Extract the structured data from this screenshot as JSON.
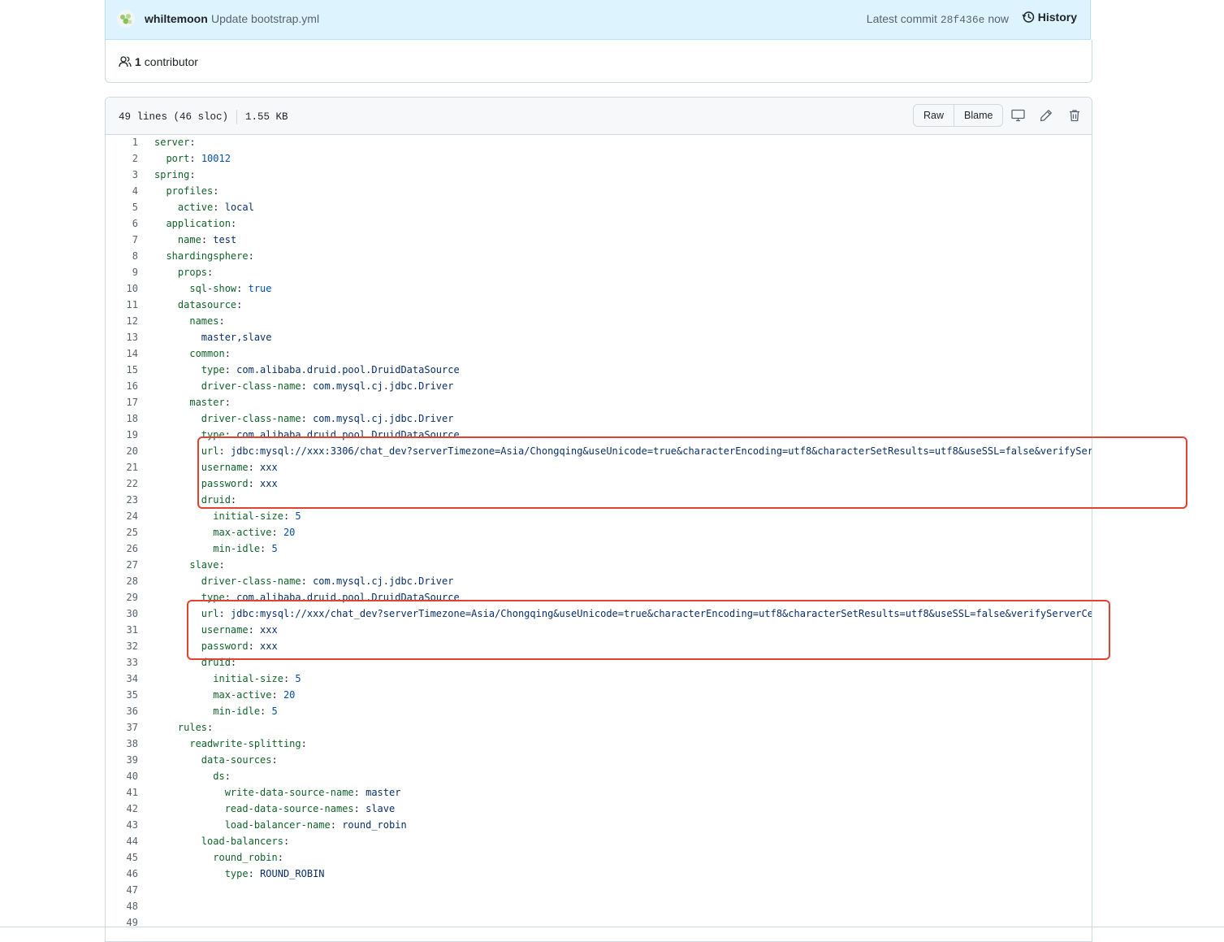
{
  "commit": {
    "author": "whiltemoon",
    "message": "Update bootstrap.yml",
    "latest_label": "Latest commit",
    "sha": "28f436e",
    "time": "now",
    "history_label": "History"
  },
  "contributors": {
    "count": "1",
    "label": "contributor"
  },
  "file": {
    "lines_info": "49 lines (46 sloc)",
    "size": "1.55 KB",
    "raw_label": "Raw",
    "blame_label": "Blame",
    "icons": [
      "desktop-icon",
      "pencil-icon",
      "trash-icon"
    ]
  },
  "code_lines": [
    {
      "n": "1",
      "indent": "",
      "key": "server",
      "value": "",
      "vtype": ""
    },
    {
      "n": "2",
      "indent": "  ",
      "key": "port",
      "value": "10012",
      "vtype": "n"
    },
    {
      "n": "3",
      "indent": "",
      "key": "spring",
      "value": "",
      "vtype": ""
    },
    {
      "n": "4",
      "indent": "  ",
      "key": "profiles",
      "value": "",
      "vtype": ""
    },
    {
      "n": "5",
      "indent": "    ",
      "key": "active",
      "value": "local",
      "vtype": "s"
    },
    {
      "n": "6",
      "indent": "  ",
      "key": "application",
      "value": "",
      "vtype": ""
    },
    {
      "n": "7",
      "indent": "    ",
      "key": "name",
      "value": "test",
      "vtype": "s"
    },
    {
      "n": "8",
      "indent": "  ",
      "key": "shardingsphere",
      "value": "",
      "vtype": ""
    },
    {
      "n": "9",
      "indent": "    ",
      "key": "props",
      "value": "",
      "vtype": ""
    },
    {
      "n": "10",
      "indent": "      ",
      "key": "sql-show",
      "value": "true",
      "vtype": "n"
    },
    {
      "n": "11",
      "indent": "    ",
      "key": "datasource",
      "value": "",
      "vtype": ""
    },
    {
      "n": "12",
      "indent": "      ",
      "key": "names",
      "value": "",
      "vtype": ""
    },
    {
      "n": "13",
      "indent": "        ",
      "key": "",
      "value": "master,slave",
      "vtype": "s"
    },
    {
      "n": "14",
      "indent": "      ",
      "key": "common",
      "value": "",
      "vtype": ""
    },
    {
      "n": "15",
      "indent": "        ",
      "key": "type",
      "value": "com.alibaba.druid.pool.DruidDataSource",
      "vtype": "s"
    },
    {
      "n": "16",
      "indent": "        ",
      "key": "driver-class-name",
      "value": "com.mysql.cj.jdbc.Driver",
      "vtype": "s"
    },
    {
      "n": "17",
      "indent": "      ",
      "key": "master",
      "value": "",
      "vtype": ""
    },
    {
      "n": "18",
      "indent": "        ",
      "key": "driver-class-name",
      "value": "com.mysql.cj.jdbc.Driver",
      "vtype": "s"
    },
    {
      "n": "19",
      "indent": "        ",
      "key": "type",
      "value": "com.alibaba.druid.pool.DruidDataSource",
      "vtype": "s"
    },
    {
      "n": "20",
      "indent": "        ",
      "key": "url",
      "value": "jdbc:mysql://xxx:3306/chat_dev?serverTimezone=Asia/Chongqing&useUnicode=true&characterEncoding=utf8&characterSetResults=utf8&useSSL=false&verifySer",
      "vtype": "s"
    },
    {
      "n": "21",
      "indent": "        ",
      "key": "username",
      "value": "xxx",
      "vtype": "s"
    },
    {
      "n": "22",
      "indent": "        ",
      "key": "password",
      "value": "xxx",
      "vtype": "s"
    },
    {
      "n": "23",
      "indent": "        ",
      "key": "druid",
      "value": "",
      "vtype": ""
    },
    {
      "n": "24",
      "indent": "          ",
      "key": "initial-size",
      "value": "5",
      "vtype": "n"
    },
    {
      "n": "25",
      "indent": "          ",
      "key": "max-active",
      "value": "20",
      "vtype": "n"
    },
    {
      "n": "26",
      "indent": "          ",
      "key": "min-idle",
      "value": "5",
      "vtype": "n"
    },
    {
      "n": "27",
      "indent": "      ",
      "key": "slave",
      "value": "",
      "vtype": ""
    },
    {
      "n": "28",
      "indent": "        ",
      "key": "driver-class-name",
      "value": "com.mysql.cj.jdbc.Driver",
      "vtype": "s"
    },
    {
      "n": "29",
      "indent": "        ",
      "key": "type",
      "value": "com.alibaba.druid.pool.DruidDataSource",
      "vtype": "s"
    },
    {
      "n": "30",
      "indent": "        ",
      "key": "url",
      "value": "jdbc:mysql://xxx/chat_dev?serverTimezone=Asia/Chongqing&useUnicode=true&characterEncoding=utf8&characterSetResults=utf8&useSSL=false&verifyServerCe",
      "vtype": "s"
    },
    {
      "n": "31",
      "indent": "        ",
      "key": "username",
      "value": "xxx",
      "vtype": "s"
    },
    {
      "n": "32",
      "indent": "        ",
      "key": "password",
      "value": "xxx",
      "vtype": "s"
    },
    {
      "n": "33",
      "indent": "        ",
      "key": "druid",
      "value": "",
      "vtype": ""
    },
    {
      "n": "34",
      "indent": "          ",
      "key": "initial-size",
      "value": "5",
      "vtype": "n"
    },
    {
      "n": "35",
      "indent": "          ",
      "key": "max-active",
      "value": "20",
      "vtype": "n"
    },
    {
      "n": "36",
      "indent": "          ",
      "key": "min-idle",
      "value": "5",
      "vtype": "n"
    },
    {
      "n": "37",
      "indent": "    ",
      "key": "rules",
      "value": "",
      "vtype": ""
    },
    {
      "n": "38",
      "indent": "      ",
      "key": "readwrite-splitting",
      "value": "",
      "vtype": ""
    },
    {
      "n": "39",
      "indent": "        ",
      "key": "data-sources",
      "value": "",
      "vtype": ""
    },
    {
      "n": "40",
      "indent": "          ",
      "key": "ds",
      "value": "",
      "vtype": ""
    },
    {
      "n": "41",
      "indent": "            ",
      "key": "write-data-source-name",
      "value": "master",
      "vtype": "s"
    },
    {
      "n": "42",
      "indent": "            ",
      "key": "read-data-source-names",
      "value": "slave",
      "vtype": "s"
    },
    {
      "n": "43",
      "indent": "            ",
      "key": "load-balancer-name",
      "value": "round_robin",
      "vtype": "s"
    },
    {
      "n": "44",
      "indent": "        ",
      "key": "load-balancers",
      "value": "",
      "vtype": ""
    },
    {
      "n": "45",
      "indent": "          ",
      "key": "round_robin",
      "value": "",
      "vtype": ""
    },
    {
      "n": "46",
      "indent": "            ",
      "key": "type",
      "value": "ROUND_ROBIN",
      "vtype": "s"
    },
    {
      "n": "47",
      "indent": "",
      "key": "",
      "value": "",
      "vtype": ""
    },
    {
      "n": "48",
      "indent": "",
      "key": "",
      "value": "",
      "vtype": ""
    },
    {
      "n": "49",
      "indent": "",
      "key": "",
      "value": "",
      "vtype": ""
    }
  ],
  "annotations": {
    "highlight_color": "#e0432f",
    "boxes": [
      {
        "label": "highlight-master-credentials",
        "from_line": "20",
        "to_line": "23"
      },
      {
        "label": "highlight-slave-credentials",
        "from_line": "30",
        "to_line": "32"
      }
    ]
  }
}
